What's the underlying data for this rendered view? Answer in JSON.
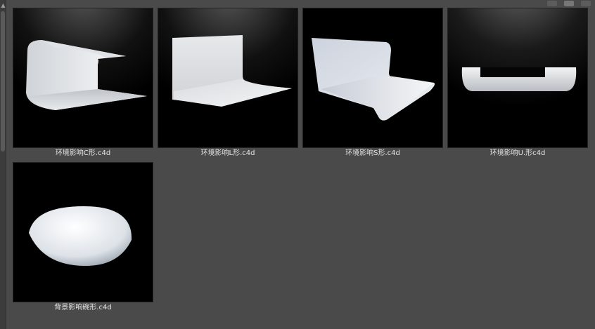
{
  "browser": {
    "items": [
      {
        "filename": "环境影响C形.c4d",
        "thumbnail_icon": "c-shape-backdrop-render"
      },
      {
        "filename": "环境影响L形.c4d",
        "thumbnail_icon": "l-shape-backdrop-render"
      },
      {
        "filename": "环境影响S形.c4d",
        "thumbnail_icon": "s-shape-backdrop-render"
      },
      {
        "filename": "环境影响U.形c4d",
        "thumbnail_icon": "u-shape-backdrop-render"
      },
      {
        "filename": "背景影响碗形.c4d",
        "thumbnail_icon": "bowl-shape-backdrop-render"
      }
    ]
  },
  "colors": {
    "panel_bg": "#4a4a4a",
    "thumb_bg": "#000000",
    "caption_text": "#e6e6e6"
  }
}
